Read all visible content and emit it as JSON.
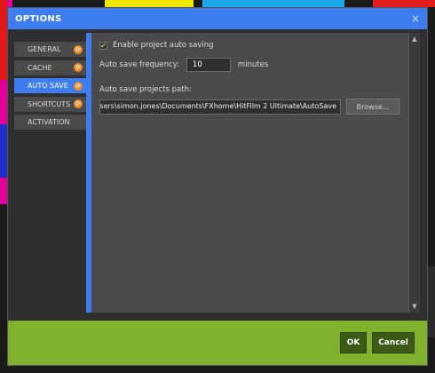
{
  "window": {
    "title": "OPTIONS",
    "close_glyph": "×"
  },
  "sidebar": {
    "items": [
      {
        "label": "GENERAL",
        "has_badge": true,
        "active": false
      },
      {
        "label": "CACHE",
        "has_badge": true,
        "active": false
      },
      {
        "label": "AUTO SAVE",
        "has_badge": true,
        "active": true
      },
      {
        "label": "SHORTCUTS",
        "has_badge": true,
        "active": false
      },
      {
        "label": "ACTIVATION",
        "has_badge": false,
        "active": false
      }
    ],
    "badge_glyph": "⟳"
  },
  "autosave": {
    "enable_label": "Enable project auto saving",
    "enable_checked": true,
    "check_glyph": "✔",
    "frequency_label": "Auto save frequency:",
    "frequency_value": "10",
    "frequency_unit": "minutes",
    "path_label": "Auto save projects path:",
    "path_value": "sers\\simon.jones\\Documents\\FXhome\\HitFilm 2 Ultimate\\AutoSave",
    "browse_label": "Browse..."
  },
  "scrollbar": {
    "up_glyph": "▲",
    "down_glyph": "▼"
  },
  "footer": {
    "ok_label": "OK",
    "cancel_label": "Cancel"
  },
  "colors": {
    "title_bar": "#3d7df0",
    "active_nav": "#3d7df0",
    "badge": "#f08a24",
    "footer": "#7fb12c",
    "footer_button": "#3a5a15"
  },
  "icons": {
    "close": "close-icon",
    "nav_badge": "refresh-badge-icon",
    "check": "checkmark-icon",
    "scroll_up": "arrow-up-icon",
    "scroll_down": "arrow-down-icon"
  }
}
